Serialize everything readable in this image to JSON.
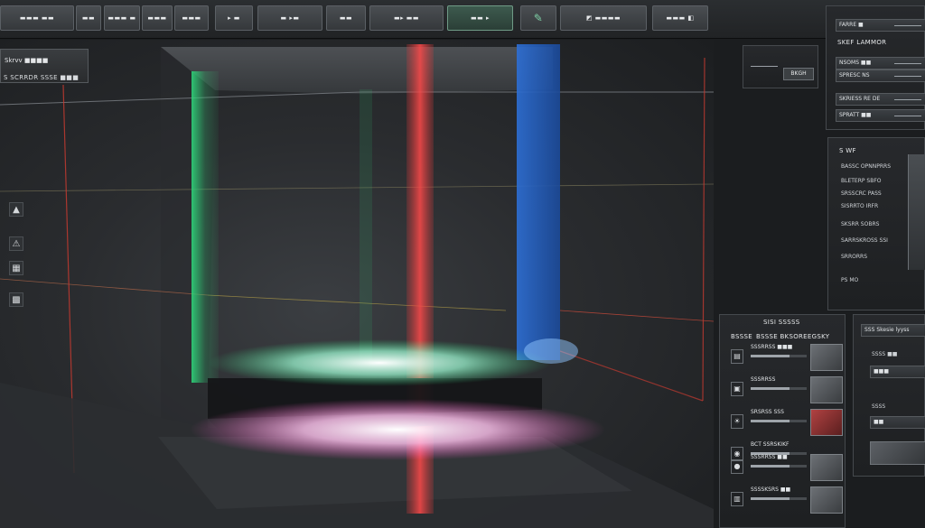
{
  "toolbar": {
    "buttons": [
      {
        "label": "▬▬▬ ▬▬"
      },
      {
        "label": "▬▬"
      },
      {
        "label": "▬▬▬ ▬"
      },
      {
        "label": "▬▬▬"
      },
      {
        "label": "▬▬▬"
      },
      {
        "label": "▸ ▬"
      },
      {
        "label": "▬ ▸▬"
      },
      {
        "label": "▬▬"
      },
      {
        "label": "▬▸ ▬▬"
      },
      {
        "label": "▬▬ ▸"
      },
      {
        "label": "◩ ▬▬▬▬"
      },
      {
        "label": "▬▬▬ ◧"
      }
    ]
  },
  "viewport": {
    "label": "Skrvv ■■■■",
    "title": "S SCRRDR SSSE ■■■",
    "side_tools": [
      {
        "icon": "triangle-up-icon",
        "glyph": "▲"
      },
      {
        "icon": "warning-icon",
        "glyph": "⚠"
      },
      {
        "icon": "box-icon",
        "glyph": "▦"
      },
      {
        "icon": "grid-icon",
        "glyph": "▩"
      }
    ]
  },
  "panels": {
    "properties": {
      "title": "SKEF LAMMOR",
      "rows": [
        "FARRE ■",
        "NSOMS ■■",
        "SPRESC NS",
        "SKRIESS RE DE",
        "SPRATT ■■"
      ]
    },
    "render_preview": {
      "label": "BKGH"
    },
    "layers": {
      "title": "S WF",
      "rows": [
        "BASSC OPNNPRRS",
        "BLETERP SBFO",
        "SRSSCRC PASS",
        "SISRRTO IRFR",
        "SKSRR SOBRS",
        "SARRSKROSS SSI",
        "SRRORRS",
        "PS MO"
      ]
    },
    "materials": {
      "title": "SISI SSSSS",
      "header_left": "BSSSE",
      "header_right": "BSSSE BKSOREEGSKY",
      "items": [
        {
          "icon": "file-icon",
          "label": "SSSRRSS ■■■"
        },
        {
          "icon": "cube-icon",
          "label": "SSSRRSS"
        },
        {
          "icon": "light-icon",
          "label": "SRSRSS SSS"
        },
        {
          "icon": "camera-icon",
          "label": "BCT SSRSKIKF"
        },
        {
          "icon": "sphere-icon",
          "label": "SSSRRSS ■■"
        },
        {
          "icon": "texture-icon",
          "label": "SSSSKSRS ■■"
        }
      ]
    },
    "output": {
      "title": "SSS Skesie lyyss",
      "rows": [
        "SSSS ■■",
        "■■■",
        "SSSS",
        "■■"
      ]
    }
  },
  "colors": {
    "green": "#2fd47a",
    "red": "#e23a3a",
    "blue": "#2d6fd6",
    "pink": "#ff58c8"
  }
}
